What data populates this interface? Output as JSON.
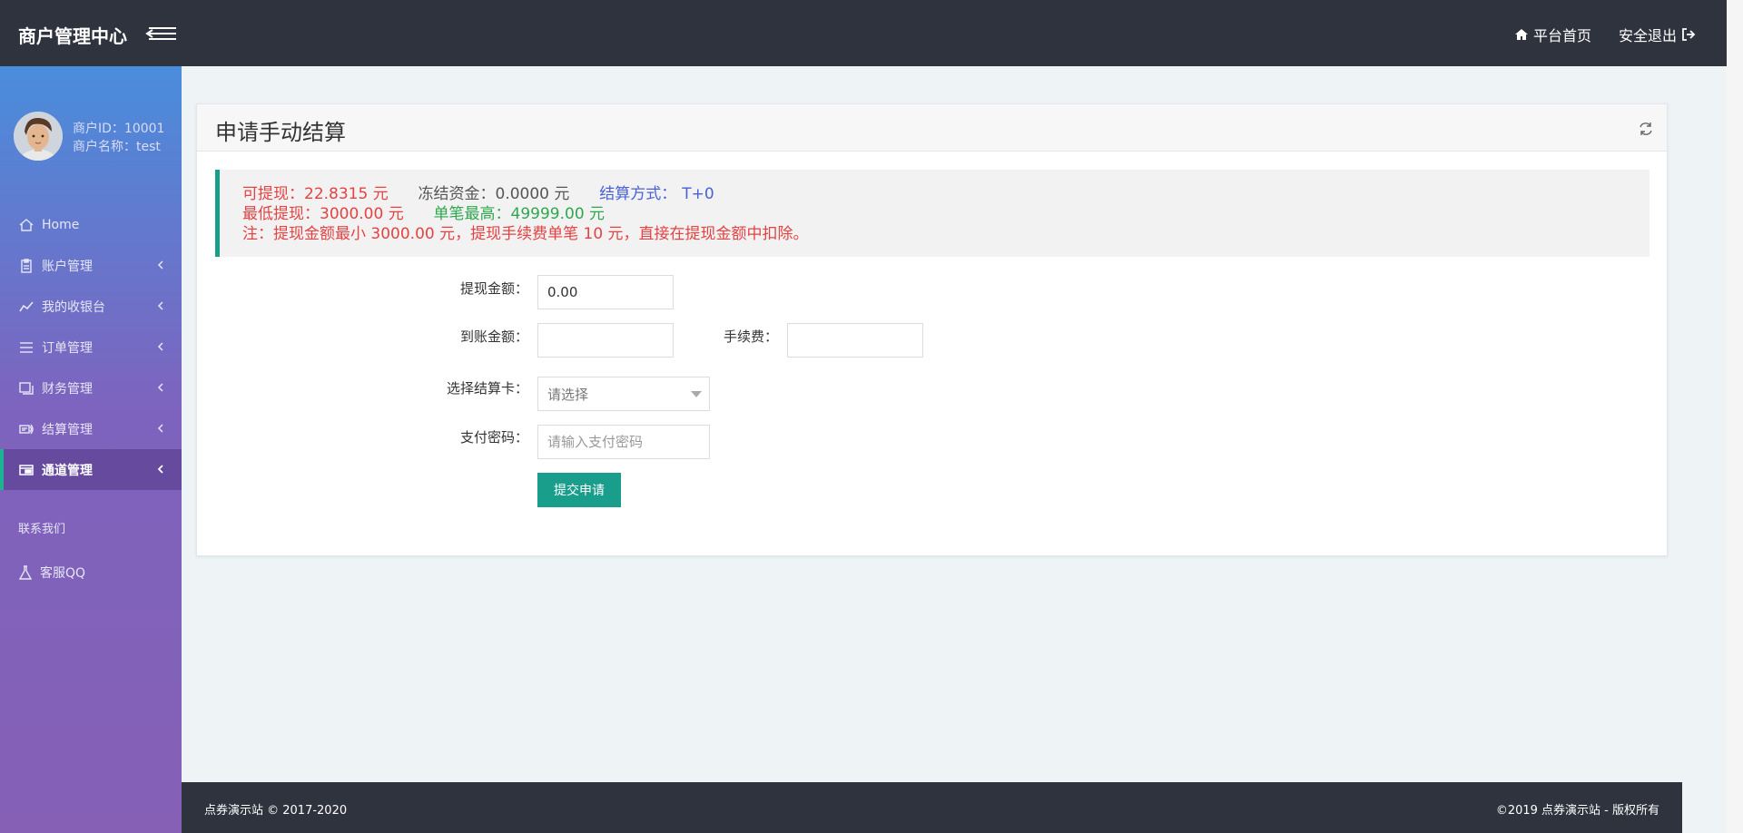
{
  "header": {
    "brand": "商户管理中心",
    "home_link": "平台首页",
    "logout_link": "安全退出"
  },
  "user": {
    "id_text": "商户ID：10001",
    "name_text": "商户名称：test"
  },
  "sidebar": {
    "items": [
      {
        "label": "Home",
        "icon": "home-icon"
      },
      {
        "label": "账户管理",
        "icon": "clipboard-icon"
      },
      {
        "label": "我的收银台",
        "icon": "chart-line-icon"
      },
      {
        "label": "订单管理",
        "icon": "list-icon"
      },
      {
        "label": "财务管理",
        "icon": "copy-icon"
      },
      {
        "label": "结算管理",
        "icon": "settlement-icon"
      },
      {
        "label": "通道管理",
        "icon": "channel-icon"
      }
    ],
    "active_index": 6,
    "contact_title": "联系我们",
    "qq_label": "客服QQ"
  },
  "panel": {
    "title": "申请手动结算",
    "alert": {
      "available_label": "可提现：",
      "available_value": "22.8315 元",
      "frozen_label": "冻结资金：",
      "frozen_value": "0.0000 元",
      "method_label": "结算方式：",
      "method_value": "T+0",
      "min_label": "最低提现：",
      "min_value": "3000.00 元",
      "max_label": "单笔最高：",
      "max_value": "49999.00 元",
      "note": "注：提现金额最小 3000.00 元，提现手续费单笔 10 元，直接在提现金额中扣除。"
    },
    "form": {
      "amount_label": "提现金额：",
      "amount_value": "0.00",
      "arrival_label": "到账金额：",
      "arrival_value": "",
      "fee_label": "手续费：",
      "fee_value": "",
      "card_label": "选择结算卡：",
      "card_placeholder": "请选择",
      "password_label": "支付密码：",
      "password_placeholder": "请输入支付密码",
      "submit_label": "提交申请"
    }
  },
  "footer": {
    "left": "点券演示站 © 2017-2020",
    "right": "©2019 点券演示站 - 版权所有"
  },
  "colors": {
    "topbar": "#2f333e",
    "accent": "#1a9e8c",
    "red": "#e64242",
    "blue": "#4a61d6",
    "green": "#2ea84e"
  }
}
